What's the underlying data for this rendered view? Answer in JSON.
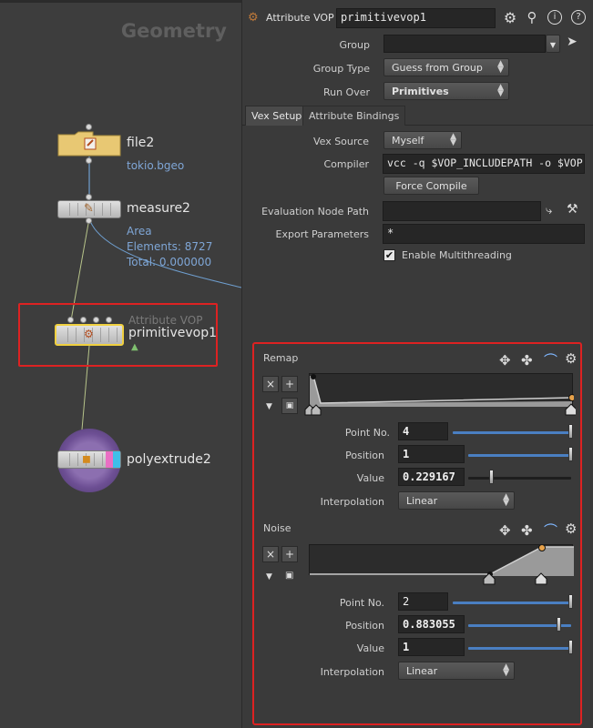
{
  "network": {
    "context_title": "Geometry",
    "nodes": {
      "file": {
        "name": "file2",
        "info": "tokio.bgeo"
      },
      "measure": {
        "name": "measure2",
        "info_lines": [
          "Area",
          "Elements: 8727",
          "Total: 0.000000"
        ]
      },
      "vop": {
        "type_label": "Attribute VOP",
        "name": "primitivevop1"
      },
      "extrude": {
        "name": "polyextrude2"
      }
    }
  },
  "params": {
    "header": {
      "node_type": "Attribute VOP",
      "node_name": "primitivevop1"
    },
    "group_label": "Group",
    "group_value": "",
    "group_type_label": "Group Type",
    "group_type_value": "Guess from Group",
    "run_over_label": "Run Over",
    "run_over_value": "Primitives",
    "tabs": [
      {
        "label": "Vex Setup",
        "active": true
      },
      {
        "label": "Attribute Bindings",
        "active": false
      }
    ],
    "vex_source_label": "Vex Source",
    "vex_source_value": "Myself",
    "compiler_label": "Compiler",
    "compiler_value": "vcc -q $VOP_INCLUDEPATH -o $VOP",
    "force_compile_label": "Force Compile",
    "eval_path_label": "Evaluation Node Path",
    "eval_path_value": "",
    "export_params_label": "Export Parameters",
    "export_params_value": "*",
    "multithreading_label": "Enable Multithreading",
    "multithreading_checked": true,
    "remap": {
      "title": "Remap",
      "point_no_label": "Point No.",
      "point_no_value": "4",
      "position_label": "Position",
      "position_value": "1",
      "value_label": "Value",
      "value_value": "0.229167",
      "interp_label": "Interpolation",
      "interp_value": "Linear"
    },
    "noise": {
      "title": "Noise",
      "point_no_label": "Point No.",
      "point_no_value": "2",
      "position_label": "Position",
      "position_value": "0.883055",
      "value_label": "Value",
      "value_value": "1",
      "interp_label": "Interpolation",
      "interp_value": "Linear"
    }
  },
  "icons": {
    "gear": "gear-icon",
    "search": "search-icon",
    "info": "info-icon",
    "help": "help-icon"
  },
  "colors": {
    "highlight": "#dd2222",
    "slider": "#4a7fc2",
    "node_info": "#7fa6d6"
  }
}
